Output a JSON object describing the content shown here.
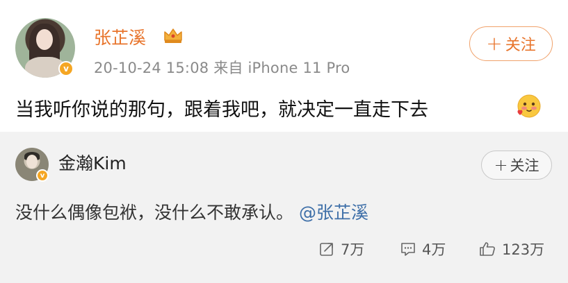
{
  "post": {
    "author": "张芷溪",
    "timestamp": "20-10-24 15:08",
    "source": "来自 iPhone 11 Pro",
    "follow_label": "关注",
    "follow_plus": "+",
    "text": "当我听你说的那句，跟着我吧，就决定一直走下去",
    "verified_badge": "v",
    "name_color": "#e8742b"
  },
  "repost": {
    "author": "金瀚Kim",
    "follow_label": "关注",
    "follow_plus": "+",
    "text": "没什么偶像包袱，没什么不敢承认。",
    "mention": "@张芷溪",
    "verified_badge": "v",
    "mention_color": "#3e6fa8"
  },
  "actions": {
    "share_count": "7万",
    "comment_count": "4万",
    "like_count": "123万"
  },
  "icons": {
    "crown": "crown-icon",
    "emoji": "blush-emoji-icon",
    "share": "share-icon",
    "comment": "comment-icon",
    "like": "thumbs-up-icon"
  }
}
